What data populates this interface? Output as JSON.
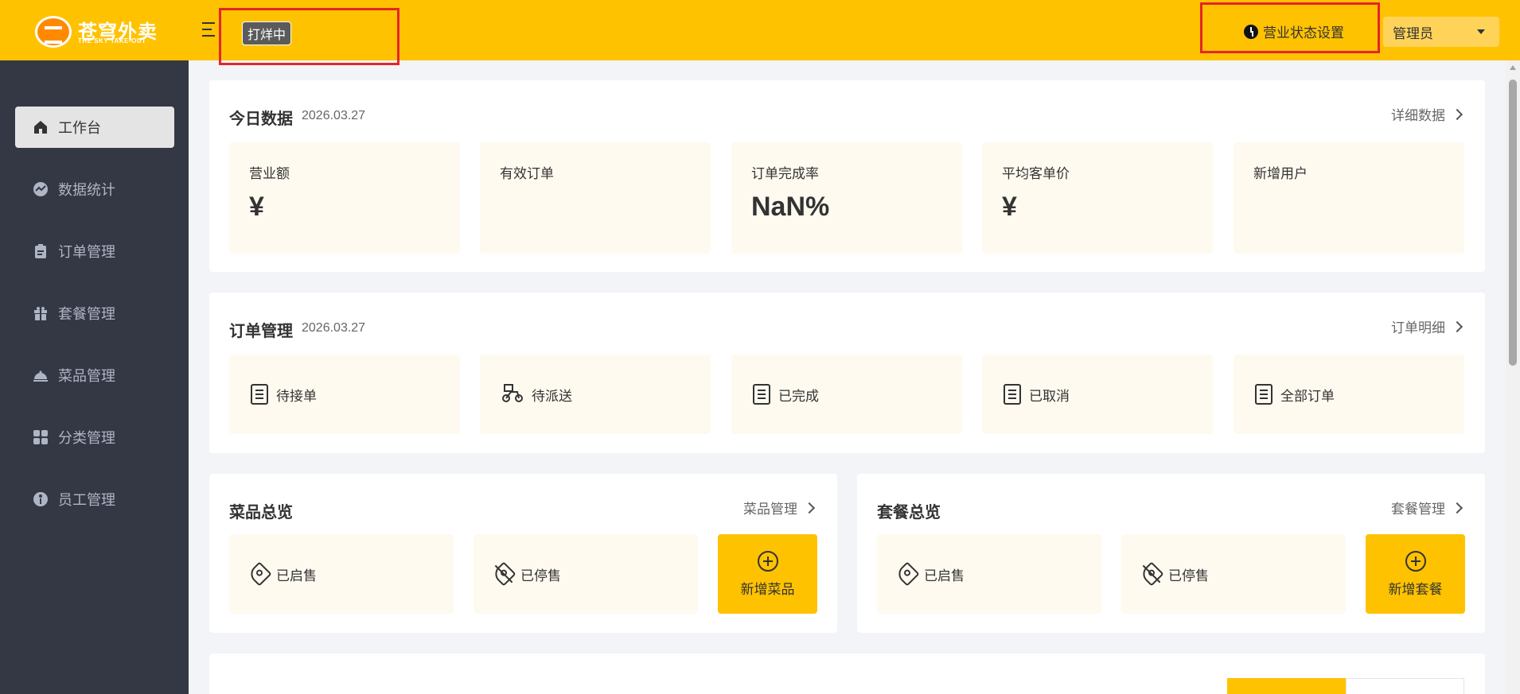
{
  "header": {
    "logo_title": "苍穹外卖",
    "logo_subtitle": "THE SKY TAKE-OUT",
    "shop_status": "打烊中",
    "business_setting": "营业状态设置",
    "user": "管理员"
  },
  "sidebar": {
    "items": [
      {
        "label": "工作台",
        "icon": "home-icon",
        "active": true
      },
      {
        "label": "数据统计",
        "icon": "chart-icon",
        "active": false
      },
      {
        "label": "订单管理",
        "icon": "clipboard-icon",
        "active": false
      },
      {
        "label": "套餐管理",
        "icon": "gift-icon",
        "active": false
      },
      {
        "label": "菜品管理",
        "icon": "cloche-icon",
        "active": false
      },
      {
        "label": "分类管理",
        "icon": "grid-icon",
        "active": false
      },
      {
        "label": "员工管理",
        "icon": "employee-icon",
        "active": false
      }
    ]
  },
  "today": {
    "title": "今日数据",
    "date": "2026.03.27",
    "link": "详细数据",
    "stats": [
      {
        "label": "营业额",
        "value": "¥"
      },
      {
        "label": "有效订单",
        "value": ""
      },
      {
        "label": "订单完成率",
        "value": "NaN%"
      },
      {
        "label": "平均客单价",
        "value": "¥"
      },
      {
        "label": "新增用户",
        "value": ""
      }
    ]
  },
  "orders": {
    "title": "订单管理",
    "date": "2026.03.27",
    "link": "订单明细",
    "items": [
      {
        "label": "待接单",
        "icon": "pending-order-icon"
      },
      {
        "label": "待派送",
        "icon": "delivery-icon"
      },
      {
        "label": "已完成",
        "icon": "completed-order-icon"
      },
      {
        "label": "已取消",
        "icon": "cancelled-order-icon"
      },
      {
        "label": "全部订单",
        "icon": "all-orders-icon"
      }
    ]
  },
  "dishes": {
    "title": "菜品总览",
    "link": "菜品管理",
    "on_sale": "已启售",
    "off_sale": "已停售",
    "add": "新增菜品"
  },
  "setmeals": {
    "title": "套餐总览",
    "link": "套餐管理",
    "on_sale": "已启售",
    "off_sale": "已停售",
    "add": "新增套餐"
  },
  "colors": {
    "brand": "#ffc200",
    "sidebar": "#343744",
    "tile": "#fffaf0",
    "highlight": "#e5252a"
  }
}
